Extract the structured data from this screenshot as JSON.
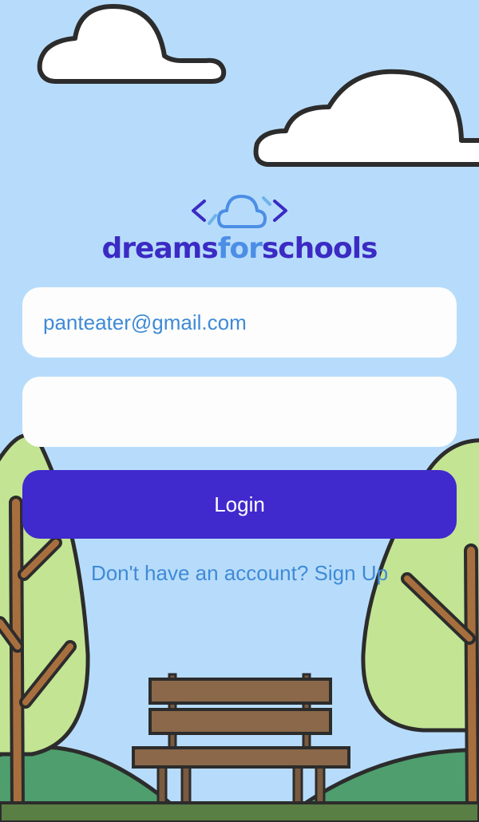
{
  "brand": {
    "name_part1": "dreams",
    "name_part2": "for",
    "name_part3": "schools",
    "logo_icon": "cloud-code-icon",
    "colors": {
      "primary": "#3b2bc4",
      "secondary": "#4c8ee6"
    }
  },
  "login_form": {
    "email_value": "panteater@gmail.com",
    "password_value": "",
    "login_label": "Login",
    "signup_prompt": "Don't have an account? Sign Up"
  },
  "theme": {
    "sky": "#b7dcfb",
    "button": "#4029cd",
    "link": "#3f8ad6",
    "tree_canopy": "#c3e493",
    "hill": "#4f9e6e",
    "bench_wood": "#8a6849"
  }
}
